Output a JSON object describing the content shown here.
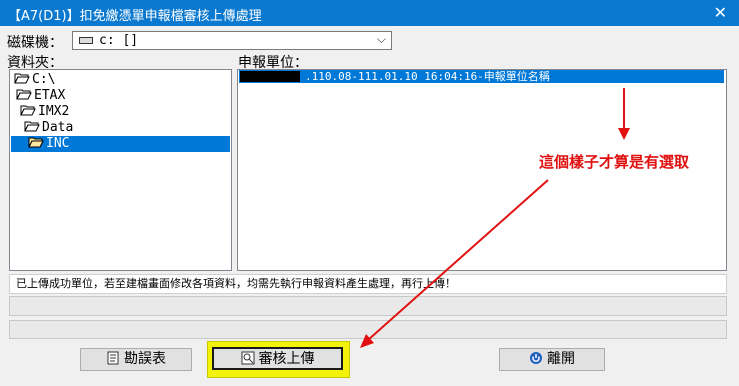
{
  "window": {
    "title": "【A7(D1)】扣免繳憑單申報檔審核上傳處理",
    "close_glyph": "✕"
  },
  "drive": {
    "label": "磁碟機：",
    "value": "c: []",
    "chevron": "⌵"
  },
  "folders": {
    "label": "資料夾：",
    "items": [
      {
        "name": "C:\\"
      },
      {
        "name": "ETAX"
      },
      {
        "name": "IMX2"
      },
      {
        "name": "Data"
      },
      {
        "name": "INC",
        "selected": true
      }
    ]
  },
  "report_unit": {
    "label": "申報單位：",
    "rows": [
      {
        "text": ".110.08-111.01.10 16:04:16-申報單位名稱",
        "selected": true
      }
    ]
  },
  "status_message": "已上傳成功單位，若至建檔畫面修改各項資料，均需先執行申報資料產生處理，再行上傳！",
  "buttons": {
    "error_table": "勘誤表",
    "review_upload": "審核上傳",
    "exit": "離開"
  },
  "annotation": {
    "text": "這個樣子才算是有選取",
    "color": "#e01010"
  },
  "colors": {
    "title_bar": "#0b79d0",
    "selection": "#0078d7",
    "highlight": "#f2f20a"
  }
}
